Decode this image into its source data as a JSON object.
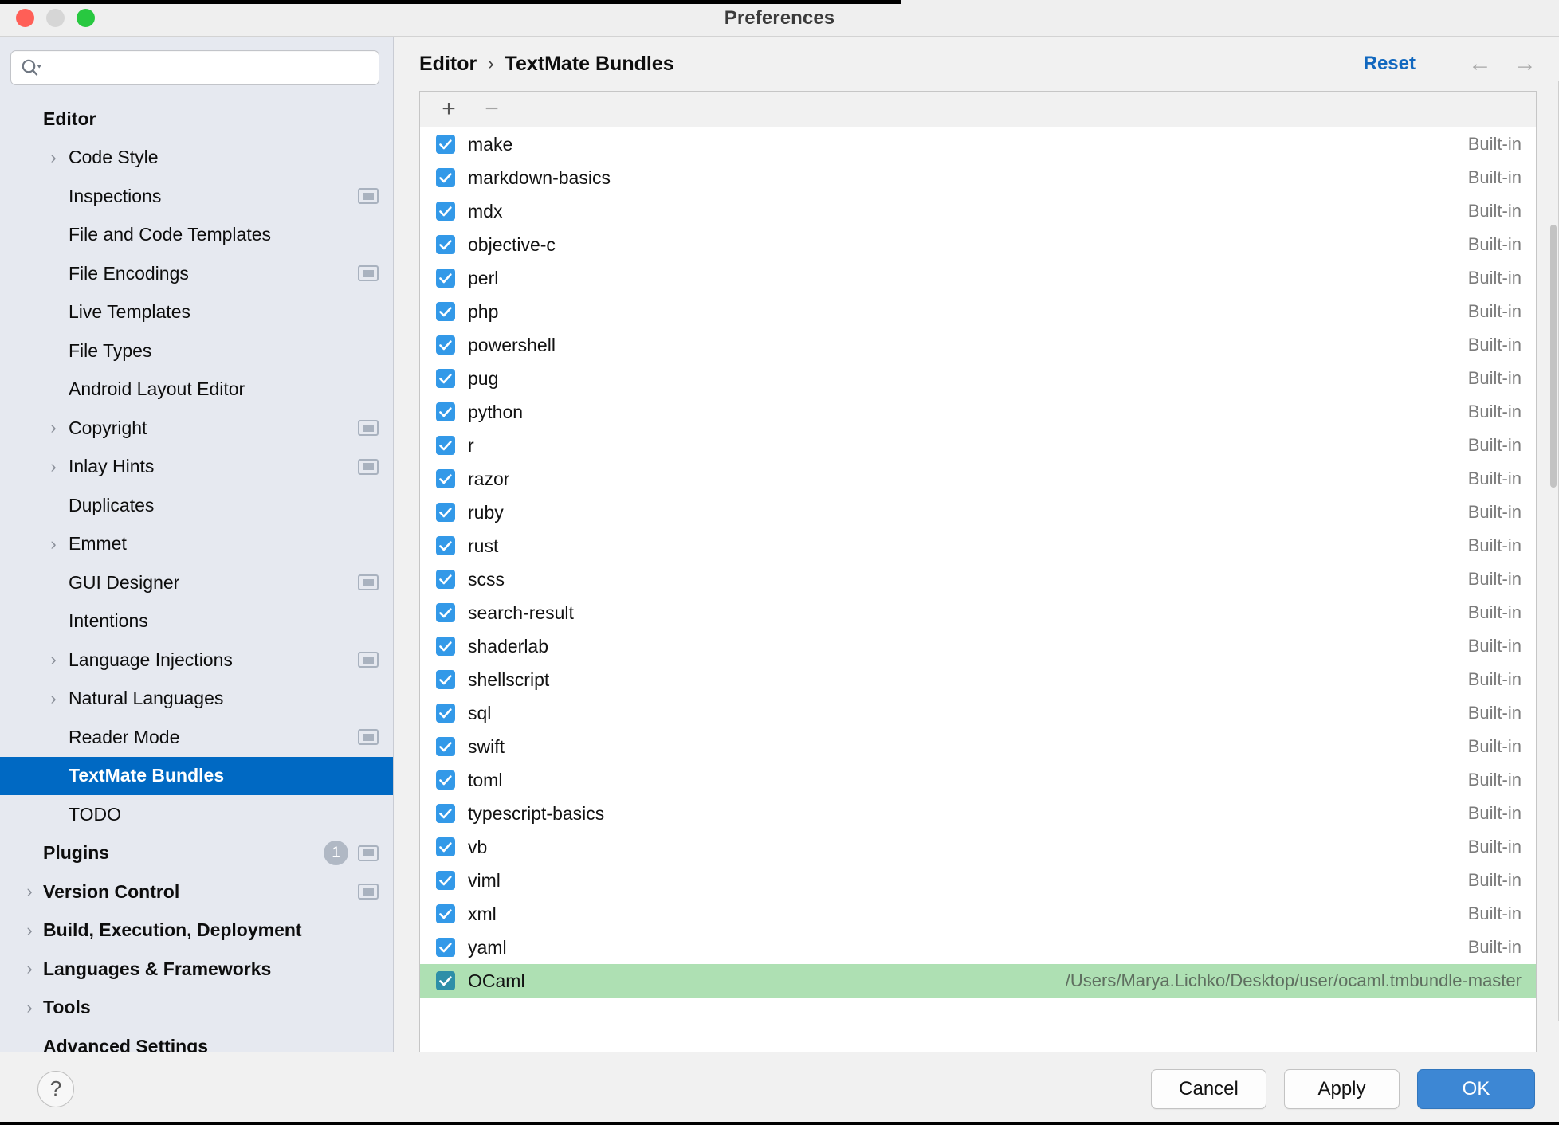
{
  "window": {
    "title": "Preferences",
    "traffic_lights": [
      "close",
      "minimize",
      "zoom"
    ]
  },
  "search": {
    "value": "",
    "placeholder": ""
  },
  "sidebar": {
    "items": [
      {
        "label": "Editor",
        "level": 0,
        "bold": true,
        "arrow": false,
        "badge": null,
        "panel_icon": false,
        "selected": false
      },
      {
        "label": "Code Style",
        "level": 1,
        "bold": false,
        "arrow": true,
        "badge": null,
        "panel_icon": false,
        "selected": false
      },
      {
        "label": "Inspections",
        "level": 1,
        "bold": false,
        "arrow": false,
        "badge": null,
        "panel_icon": true,
        "selected": false
      },
      {
        "label": "File and Code Templates",
        "level": 1,
        "bold": false,
        "arrow": false,
        "badge": null,
        "panel_icon": false,
        "selected": false
      },
      {
        "label": "File Encodings",
        "level": 1,
        "bold": false,
        "arrow": false,
        "badge": null,
        "panel_icon": true,
        "selected": false
      },
      {
        "label": "Live Templates",
        "level": 1,
        "bold": false,
        "arrow": false,
        "badge": null,
        "panel_icon": false,
        "selected": false
      },
      {
        "label": "File Types",
        "level": 1,
        "bold": false,
        "arrow": false,
        "badge": null,
        "panel_icon": false,
        "selected": false
      },
      {
        "label": "Android Layout Editor",
        "level": 1,
        "bold": false,
        "arrow": false,
        "badge": null,
        "panel_icon": false,
        "selected": false
      },
      {
        "label": "Copyright",
        "level": 1,
        "bold": false,
        "arrow": true,
        "badge": null,
        "panel_icon": true,
        "selected": false
      },
      {
        "label": "Inlay Hints",
        "level": 1,
        "bold": false,
        "arrow": true,
        "badge": null,
        "panel_icon": true,
        "selected": false
      },
      {
        "label": "Duplicates",
        "level": 1,
        "bold": false,
        "arrow": false,
        "badge": null,
        "panel_icon": false,
        "selected": false
      },
      {
        "label": "Emmet",
        "level": 1,
        "bold": false,
        "arrow": true,
        "badge": null,
        "panel_icon": false,
        "selected": false
      },
      {
        "label": "GUI Designer",
        "level": 1,
        "bold": false,
        "arrow": false,
        "badge": null,
        "panel_icon": true,
        "selected": false
      },
      {
        "label": "Intentions",
        "level": 1,
        "bold": false,
        "arrow": false,
        "badge": null,
        "panel_icon": false,
        "selected": false
      },
      {
        "label": "Language Injections",
        "level": 1,
        "bold": false,
        "arrow": true,
        "badge": null,
        "panel_icon": true,
        "selected": false
      },
      {
        "label": "Natural Languages",
        "level": 1,
        "bold": false,
        "arrow": true,
        "badge": null,
        "panel_icon": false,
        "selected": false
      },
      {
        "label": "Reader Mode",
        "level": 1,
        "bold": false,
        "arrow": false,
        "badge": null,
        "panel_icon": true,
        "selected": false
      },
      {
        "label": "TextMate Bundles",
        "level": 1,
        "bold": false,
        "arrow": false,
        "badge": null,
        "panel_icon": false,
        "selected": true
      },
      {
        "label": "TODO",
        "level": 1,
        "bold": false,
        "arrow": false,
        "badge": null,
        "panel_icon": false,
        "selected": false
      },
      {
        "label": "Plugins",
        "level": 0,
        "bold": true,
        "arrow": false,
        "badge": "1",
        "panel_icon": true,
        "selected": false
      },
      {
        "label": "Version Control",
        "level": 0,
        "bold": true,
        "arrow": true,
        "badge": null,
        "panel_icon": true,
        "selected": false
      },
      {
        "label": "Build, Execution, Deployment",
        "level": 0,
        "bold": true,
        "arrow": true,
        "badge": null,
        "panel_icon": false,
        "selected": false
      },
      {
        "label": "Languages & Frameworks",
        "level": 0,
        "bold": true,
        "arrow": true,
        "badge": null,
        "panel_icon": false,
        "selected": false
      },
      {
        "label": "Tools",
        "level": 0,
        "bold": true,
        "arrow": true,
        "badge": null,
        "panel_icon": false,
        "selected": false
      },
      {
        "label": "Advanced Settings",
        "level": 0,
        "bold": true,
        "arrow": false,
        "badge": null,
        "panel_icon": false,
        "selected": false
      }
    ]
  },
  "header": {
    "breadcrumb_root": "Editor",
    "breadcrumb_sep": "›",
    "breadcrumb_leaf": "TextMate Bundles",
    "reset_label": "Reset",
    "back_arrow": "←",
    "forward_arrow": "→"
  },
  "toolbar": {
    "add_label": "+",
    "remove_label": "−"
  },
  "bundles": [
    {
      "name": "make",
      "checked": true,
      "meta": "Built-in",
      "selected": false
    },
    {
      "name": "markdown-basics",
      "checked": true,
      "meta": "Built-in",
      "selected": false
    },
    {
      "name": "mdx",
      "checked": true,
      "meta": "Built-in",
      "selected": false
    },
    {
      "name": "objective-c",
      "checked": true,
      "meta": "Built-in",
      "selected": false
    },
    {
      "name": "perl",
      "checked": true,
      "meta": "Built-in",
      "selected": false
    },
    {
      "name": "php",
      "checked": true,
      "meta": "Built-in",
      "selected": false
    },
    {
      "name": "powershell",
      "checked": true,
      "meta": "Built-in",
      "selected": false
    },
    {
      "name": "pug",
      "checked": true,
      "meta": "Built-in",
      "selected": false
    },
    {
      "name": "python",
      "checked": true,
      "meta": "Built-in",
      "selected": false
    },
    {
      "name": "r",
      "checked": true,
      "meta": "Built-in",
      "selected": false
    },
    {
      "name": "razor",
      "checked": true,
      "meta": "Built-in",
      "selected": false
    },
    {
      "name": "ruby",
      "checked": true,
      "meta": "Built-in",
      "selected": false
    },
    {
      "name": "rust",
      "checked": true,
      "meta": "Built-in",
      "selected": false
    },
    {
      "name": "scss",
      "checked": true,
      "meta": "Built-in",
      "selected": false
    },
    {
      "name": "search-result",
      "checked": true,
      "meta": "Built-in",
      "selected": false
    },
    {
      "name": "shaderlab",
      "checked": true,
      "meta": "Built-in",
      "selected": false
    },
    {
      "name": "shellscript",
      "checked": true,
      "meta": "Built-in",
      "selected": false
    },
    {
      "name": "sql",
      "checked": true,
      "meta": "Built-in",
      "selected": false
    },
    {
      "name": "swift",
      "checked": true,
      "meta": "Built-in",
      "selected": false
    },
    {
      "name": "toml",
      "checked": true,
      "meta": "Built-in",
      "selected": false
    },
    {
      "name": "typescript-basics",
      "checked": true,
      "meta": "Built-in",
      "selected": false
    },
    {
      "name": "vb",
      "checked": true,
      "meta": "Built-in",
      "selected": false
    },
    {
      "name": "viml",
      "checked": true,
      "meta": "Built-in",
      "selected": false
    },
    {
      "name": "xml",
      "checked": true,
      "meta": "Built-in",
      "selected": false
    },
    {
      "name": "yaml",
      "checked": true,
      "meta": "Built-in",
      "selected": false
    },
    {
      "name": "OCaml",
      "checked": true,
      "meta": "/Users/Marya.Lichko/Desktop/user/ocaml.tmbundle-master",
      "selected": true
    }
  ],
  "footer": {
    "help_label": "?",
    "cancel_label": "Cancel",
    "apply_label": "Apply",
    "ok_label": "OK"
  },
  "colors": {
    "accent_selection": "#0069c3",
    "row_selected": "#aee0b3",
    "checkbox": "#3399e8",
    "primary_button": "#3d87d4",
    "link": "#1168bf"
  }
}
